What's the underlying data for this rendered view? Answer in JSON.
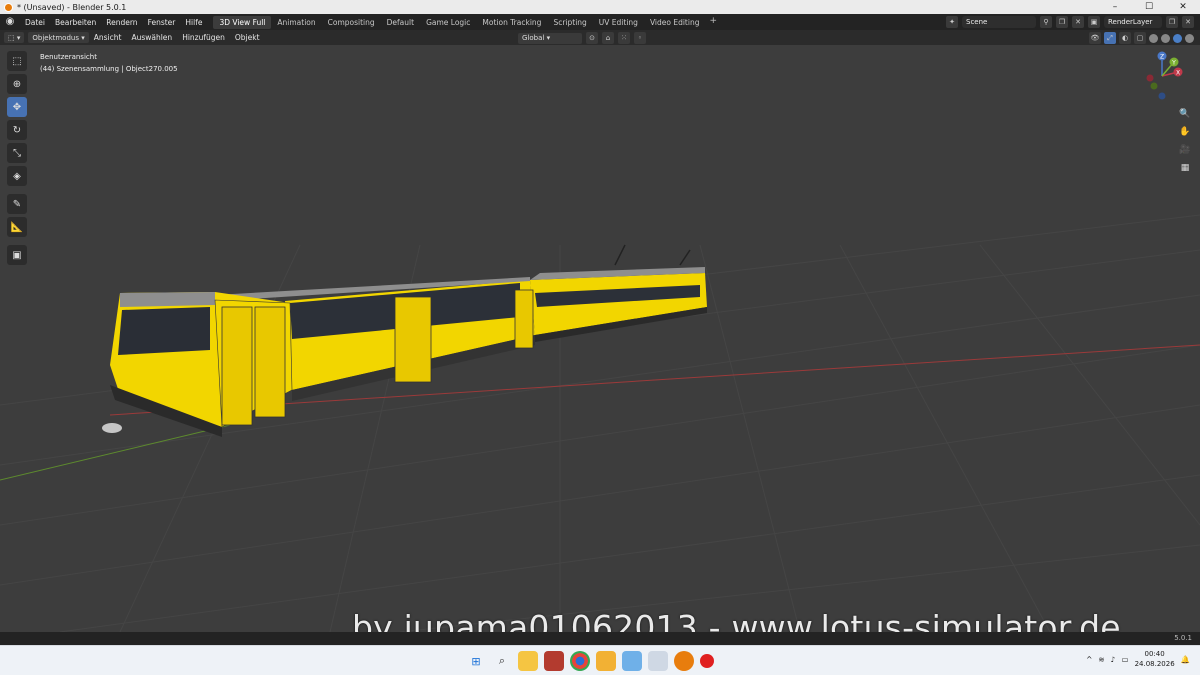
{
  "window": {
    "title": "* (Unsaved) - Blender 5.0.1",
    "controls": [
      "–",
      "☐",
      "✕"
    ]
  },
  "menu": [
    "Datei",
    "Bearbeiten",
    "Rendern",
    "Fenster",
    "Hilfe"
  ],
  "workspaces": [
    "3D View Full",
    "Animation",
    "Compositing",
    "Default",
    "Game Logic",
    "Motion Tracking",
    "Scripting",
    "UV Editing",
    "Video Editing"
  ],
  "active_workspace": "3D View Full",
  "topbar": {
    "add_label": "+",
    "scene": "Scene",
    "render_layer": "RenderLayer"
  },
  "viewport_header": {
    "mode": "Objektmodus",
    "menus": [
      "Ansicht",
      "Auswählen",
      "Hinzufügen",
      "Objekt"
    ],
    "orientation": "Global"
  },
  "overlay": {
    "view_name": "Benutzeransicht",
    "collection_info": "(44) Szenensammlung | Object270.005"
  },
  "gizmo": {
    "z": "Z",
    "y": "Y",
    "x": "X"
  },
  "icons": {
    "tools": [
      "select-box-icon",
      "cursor-icon",
      "move-icon",
      "rotate-icon",
      "scale-icon",
      "transform-icon",
      "annotate-icon",
      "measure-icon",
      "add-cube-icon"
    ],
    "nav": [
      "zoom-icon",
      "hand-pan-icon",
      "camera-icon",
      "grid-icon"
    ]
  },
  "status": {
    "version": "5.0.1"
  },
  "watermark": "by jupama01062013 - www.lotus-simulator.de",
  "taskbar": {
    "time": "00:40",
    "date": "24.08.2026"
  },
  "colors": {
    "tram_yellow": "#f2d600",
    "tram_roof": "#8e8e8e",
    "accent_blue": "#4772b3",
    "axis_red": "#9b3a3a",
    "axis_green": "#5d8a2e"
  }
}
